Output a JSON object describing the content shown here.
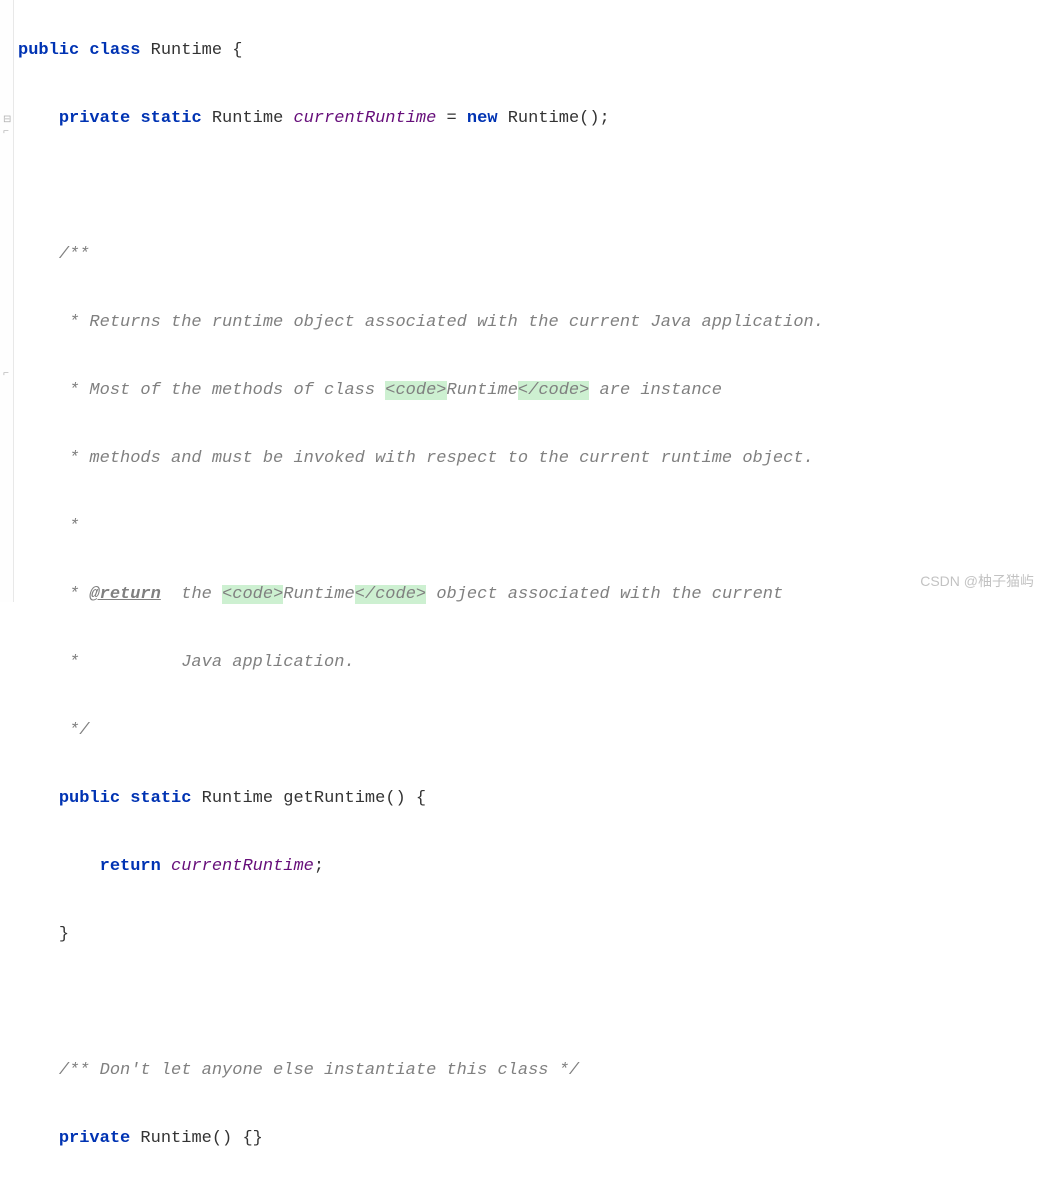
{
  "code": {
    "l1": {
      "kw1": "public",
      "kw2": "class",
      "name": "Runtime",
      "brace": "{"
    },
    "l2": {
      "indent": "    ",
      "kw1": "private",
      "kw2": "static",
      "type": "Runtime ",
      "field": "currentRuntime",
      "eq": " = ",
      "kw3": "new",
      "call": " Runtime();"
    },
    "l3": {
      "indent": "    "
    },
    "l4": {
      "indent": "    ",
      "c": "/**"
    },
    "l5": {
      "indent": "     ",
      "c": "* Returns the runtime object associated with the current Java application."
    },
    "l6": {
      "indent": "     ",
      "c1": "* Most of the methods of class ",
      "t1": "<code>",
      "c2": "Runtime",
      "t2": "</code>",
      "c3": " are instance"
    },
    "l7": {
      "indent": "     ",
      "c": "* methods and must be invoked with respect to the current runtime object."
    },
    "l8": {
      "indent": "     ",
      "c": "*"
    },
    "l9": {
      "indent": "     ",
      "c1": "* ",
      "tag": "@return",
      "c2": "  the ",
      "t1": "<code>",
      "c3": "Runtime",
      "t2": "</code>",
      "c4": " object associated with the current"
    },
    "l10": {
      "indent": "     ",
      "c": "*          Java application."
    },
    "l11": {
      "indent": "     ",
      "c": "*/"
    },
    "l12": {
      "indent": "    ",
      "kw1": "public",
      "kw2": "static",
      "type": "Runtime ",
      "method": "getRuntime",
      "rest": "() {"
    },
    "l13": {
      "indent": "        ",
      "kw": "return",
      "sp": " ",
      "field": "currentRuntime",
      "semi": ";"
    },
    "l14": {
      "indent": "    ",
      "brace": "}"
    },
    "l15": {
      "indent": "    "
    },
    "l16": {
      "indent": "    ",
      "c": "/** Don't let anyone else instantiate this class */"
    },
    "l17": {
      "indent": "    ",
      "kw": "private",
      "rest": " Runtime() {}"
    }
  },
  "watermark": "CSDN @柚子猫屿"
}
